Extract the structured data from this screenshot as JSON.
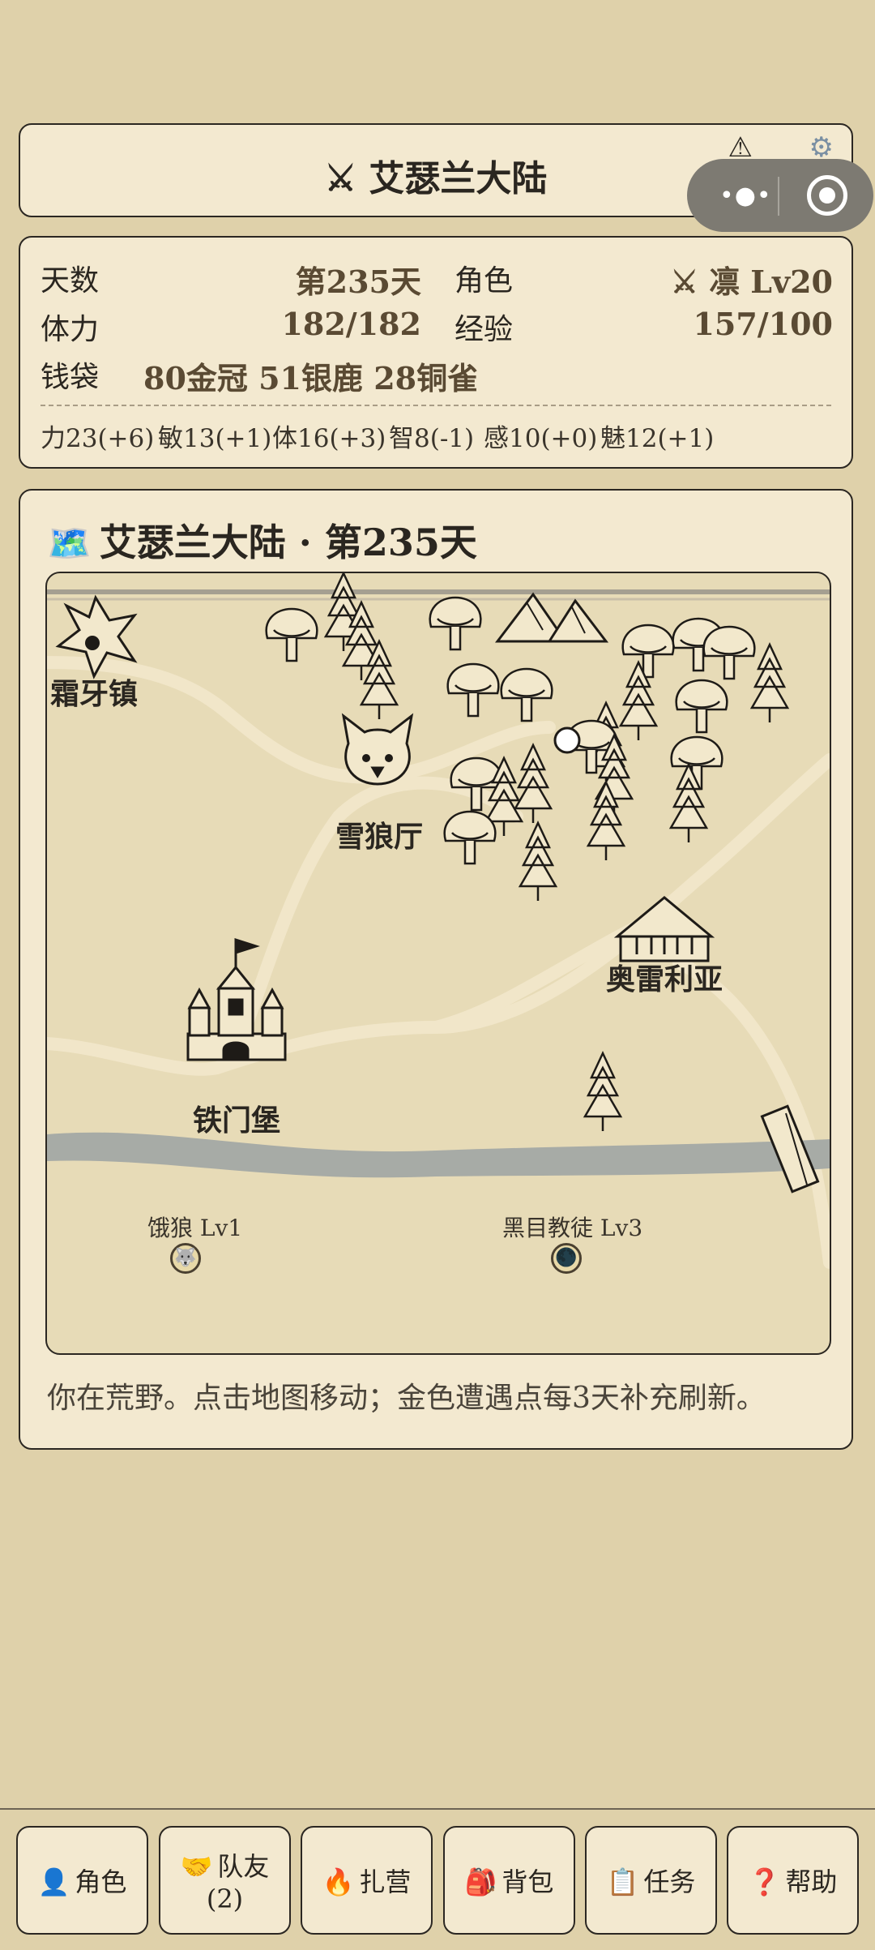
{
  "title": {
    "icon": "⚔",
    "text": "艾瑟兰大陆"
  },
  "status_icons": {
    "warning": "⚠",
    "settings": "⚙"
  },
  "capsule": {
    "more": "•●•"
  },
  "stats": {
    "days_label": "天数",
    "days_value": "第235天",
    "role_label": "角色",
    "role_value": "⚔ 凛 Lv20",
    "stamina_label": "体力",
    "stamina_value": "182/182",
    "exp_label": "经验",
    "exp_value": "157/100",
    "purse_label": "钱袋",
    "purse_value": "80金冠 51银鹿 28铜雀"
  },
  "attributes": [
    "力23(+6)",
    "敏13(+1)",
    "体16(+3)",
    "智8(-1)",
    "感10(+0)",
    "魅12(+1)"
  ],
  "map": {
    "heading_icon": "🗺️",
    "heading": "艾瑟兰大陆 · 第235天",
    "places": {
      "frost_town": "霜牙镇",
      "snow_wolf_hall": "雪狼厅",
      "orelia": "奥雷利亚",
      "iron_gate": "铁门堡"
    },
    "encounters": [
      {
        "label": "饿狼 Lv1",
        "icon": "wolf-face-icon",
        "glyph": "🐺"
      },
      {
        "label": "黑目教徒 Lv3",
        "icon": "dark-moon-icon",
        "glyph": "🌑"
      }
    ],
    "hint": "你在荒野。点击地图移动；金色遭遇点每3天补充刷新。"
  },
  "nav": [
    {
      "icon": "👤",
      "label": "角色"
    },
    {
      "icon": "🤝",
      "label": "队友",
      "sub": "(2)"
    },
    {
      "icon": "🔥",
      "label": "扎营"
    },
    {
      "icon": "🎒",
      "label": "背包"
    },
    {
      "icon": "📋",
      "label": "任务"
    },
    {
      "icon": "❓",
      "label": "帮助"
    }
  ]
}
